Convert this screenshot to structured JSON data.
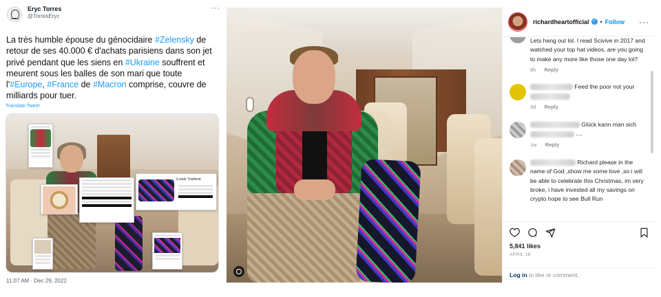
{
  "tweet": {
    "author_name": "Eryc Torres",
    "author_handle": "@TorresEryc",
    "more_icon": "more-horizontal-icon",
    "text_parts": [
      {
        "t": "La très humble épouse du génocidaire ",
        "tag": false
      },
      {
        "t": "#Zelensky",
        "tag": true
      },
      {
        "t": " de retour de ses 40.000 € d'achats parisiens dans son jet privé pendant que les siens en ",
        "tag": false
      },
      {
        "t": "#Ukraine",
        "tag": true
      },
      {
        "t": " souffrent et meurent sous les balles de son mari que toute l'",
        "tag": false
      },
      {
        "t": "#Europe",
        "tag": true
      },
      {
        "t": ", ",
        "tag": false
      },
      {
        "t": "#France",
        "tag": true
      },
      {
        "t": " de ",
        "tag": false
      },
      {
        "t": "#Macron",
        "tag": true
      },
      {
        "t": " comprise, couvre de milliards pour tuer.",
        "tag": false
      }
    ],
    "translate_label": "Translate Tweet",
    "timestamp": "11:07 AM · Dec 29, 2022",
    "media_cards": {
      "lv_title": "Louis Vuitton"
    }
  },
  "instagram": {
    "username": "richardheartofficial",
    "follow_label": "Follow",
    "comments": [
      {
        "text": "Lets hang out lol. I read Scivive in 2017 and watched your top hat videos, are you going to make any more like those one day lol?",
        "time": "8h",
        "reply_label": "Reply",
        "avatar_color": "#d9d9d9"
      },
      {
        "text": "Feed the poor not your",
        "time": "3d",
        "reply_label": "Reply",
        "avatar_color": "#e3c400"
      },
      {
        "text": "Glück kann man sich",
        "text2": "....",
        "time": "1w",
        "reply_label": "Reply",
        "avatar_color": "#bdbdbd"
      },
      {
        "text": "Richard please in the name of God ,show me some love ,so i will be able to celebrate this Christmas, im very broke, i have invested all my savings on crypto hope to see Bull Run",
        "avatar_color": "#c9b6a6"
      }
    ],
    "action_icons": [
      "heart-icon",
      "comment-icon",
      "share-icon",
      "bookmark-icon"
    ],
    "likes": "5,841 likes",
    "date": "APRIL 16",
    "login_link": "Log in",
    "login_rest": " to like or comment."
  }
}
